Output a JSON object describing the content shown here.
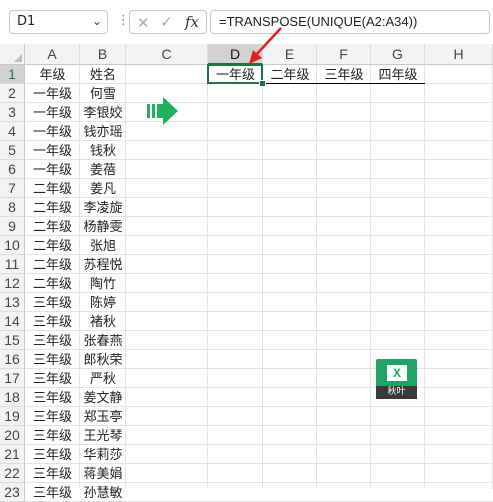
{
  "formula_bar": {
    "name_box": "D1",
    "cancel_icon": "✕",
    "enter_icon": "✓",
    "fx_label": "fx",
    "formula": "=TRANSPOSE(UNIQUE(A2:A34))"
  },
  "columns": [
    "A",
    "B",
    "C",
    "D",
    "E",
    "F",
    "G",
    "H"
  ],
  "rows": [
    "1",
    "2",
    "3",
    "4",
    "5",
    "6",
    "7",
    "8",
    "9",
    "10",
    "11",
    "12",
    "13",
    "14",
    "15",
    "16",
    "17",
    "18",
    "19",
    "20",
    "21",
    "22",
    "23"
  ],
  "col_a": [
    "年级",
    "一年级",
    "一年级",
    "一年级",
    "一年级",
    "一年级",
    "二年级",
    "二年级",
    "二年级",
    "二年级",
    "二年级",
    "二年级",
    "三年级",
    "三年级",
    "三年级",
    "三年级",
    "三年级",
    "三年级",
    "三年级",
    "三年级",
    "三年级",
    "三年级",
    "三年级"
  ],
  "col_b": [
    "姓名",
    "何雪",
    "李银姣",
    "钱亦瑶",
    "钱秋",
    "姜蓓",
    "姜凡",
    "李凌旋",
    "杨静雯",
    "张旭",
    "苏程悦",
    "陶竹",
    "陈婷",
    "褚秋",
    "张春燕",
    "郎秋荣",
    "严秋",
    "姜文静",
    "郑玉亭",
    "王光琴",
    "华莉莎",
    "蒋美娟",
    "孙慧敏"
  ],
  "row1_result": [
    "一年级",
    "二年级",
    "三年级",
    "四年级"
  ],
  "logo_text": "秋叶",
  "logo_letter": "X",
  "colors": {
    "excel_green": "#217346",
    "arrow_green": "#1fb25a",
    "red_arrow": "#e02020"
  }
}
